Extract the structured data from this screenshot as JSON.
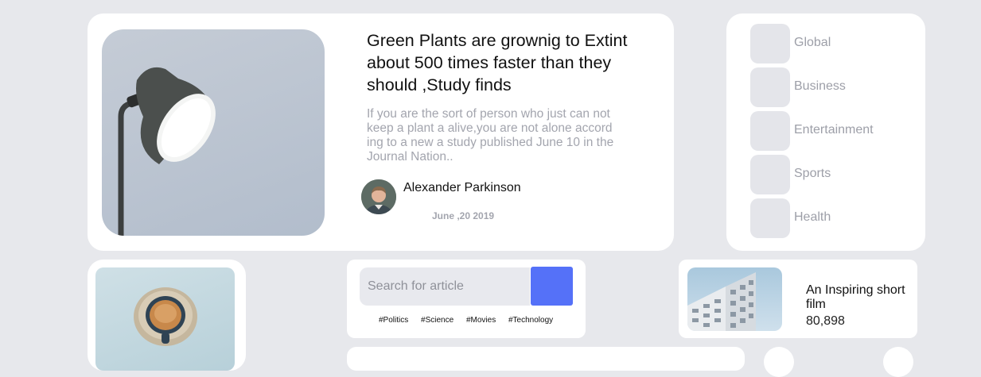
{
  "featured": {
    "title": "Green Plants are grownig to Extint about 500 times faster than they should ,Study finds",
    "excerpt": "If you are the sort of person who just can not keep a plant a alive,you are not alone accord ing to a new a study published June 10 in the Journal Nation..",
    "author": "Alexander Parkinson",
    "date": "June ,20 2019",
    "image_icon": "desk-lamp-image"
  },
  "categories": [
    {
      "label": "Global"
    },
    {
      "label": "Business"
    },
    {
      "label": "Entertainment"
    },
    {
      "label": "Sports"
    },
    {
      "label": "Health"
    }
  ],
  "search": {
    "placeholder": "Search for article",
    "tags": [
      "#Politics",
      "#Science",
      "#Movies",
      "#Technology"
    ]
  },
  "video": {
    "title": "An Inspiring short film",
    "views": "80,898",
    "image_icon": "building-image"
  },
  "coffee": {
    "image_icon": "coffee-cup-image"
  },
  "colors": {
    "background": "#e7e8ec",
    "card": "#ffffff",
    "accent": "#5571f8",
    "muted_text": "#9d9fa8",
    "tile": "#e4e5ea"
  }
}
